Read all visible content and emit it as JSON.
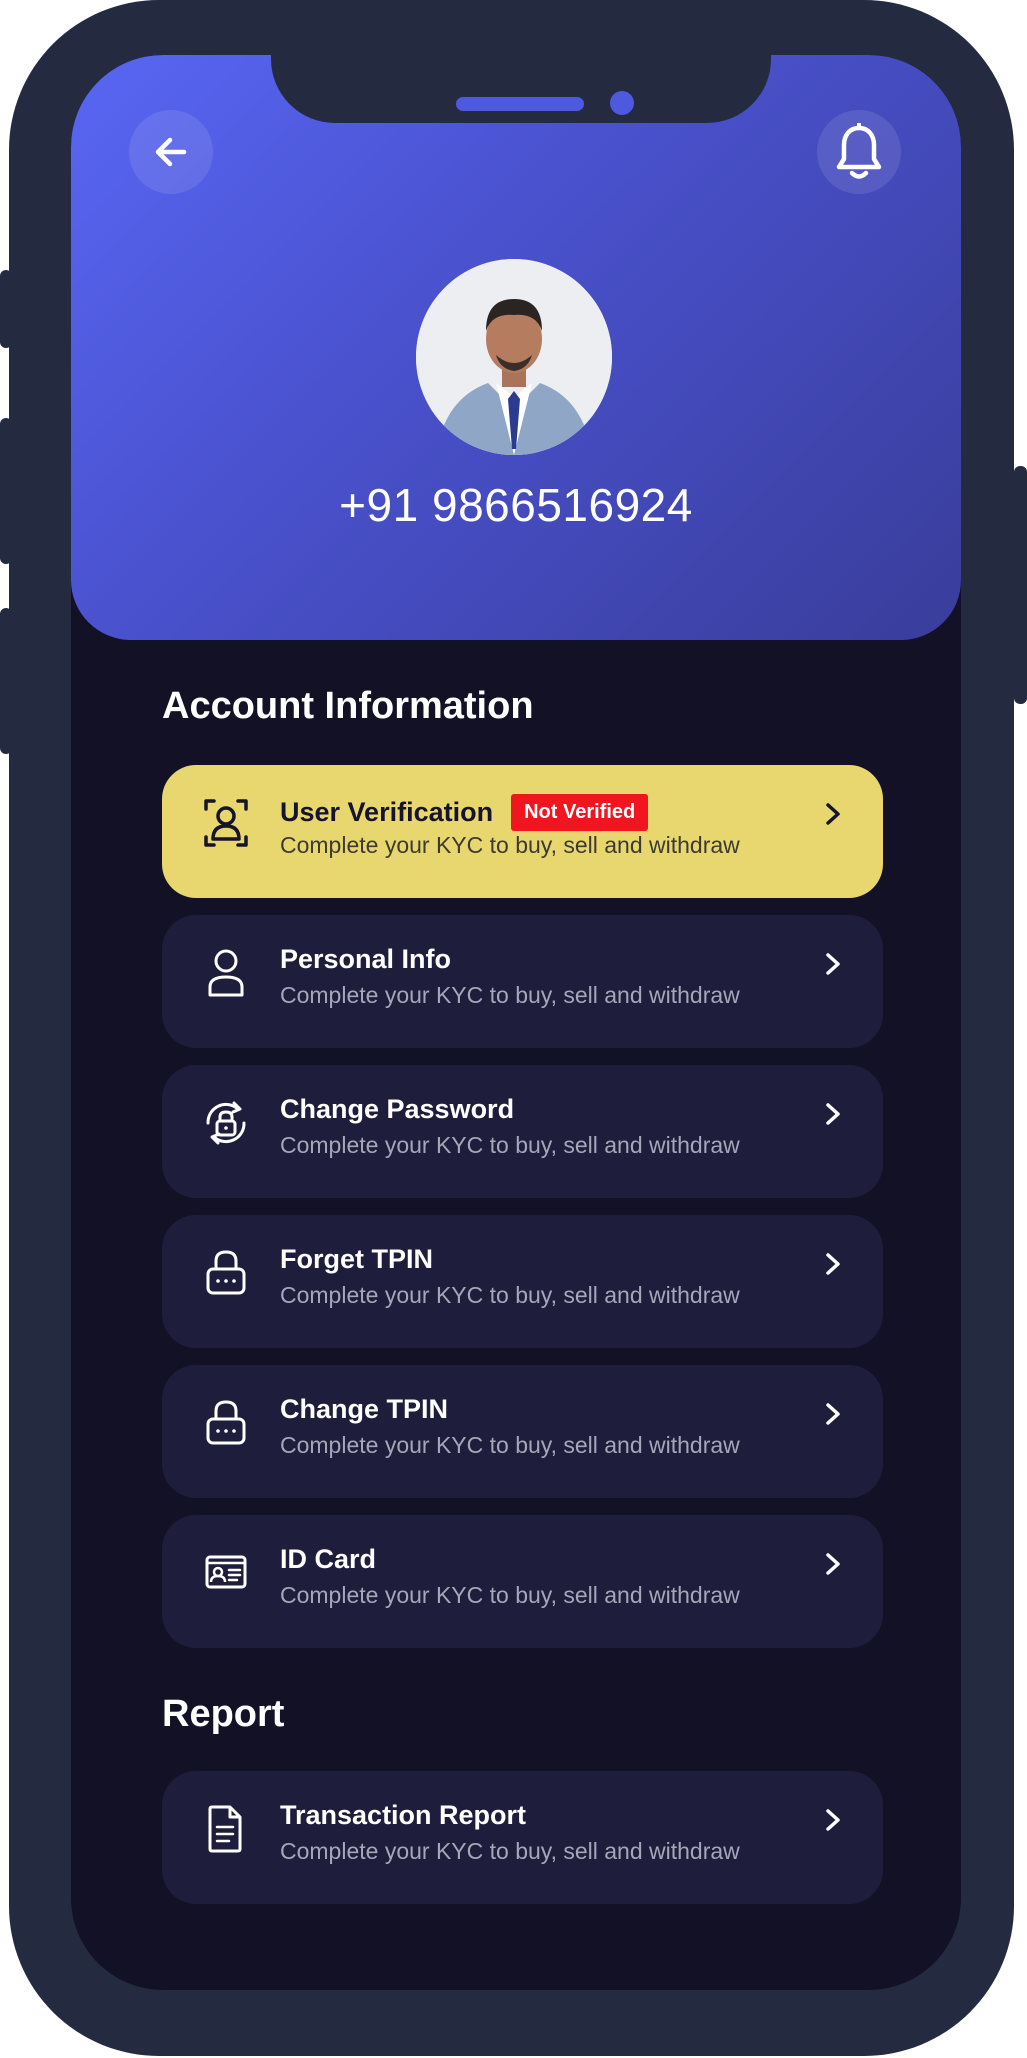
{
  "header": {
    "phone_number": "+91 9866516924",
    "back_icon": "arrow-left-icon",
    "notification_icon": "bell-icon"
  },
  "sections": {
    "account": {
      "title": "Account Information",
      "items": [
        {
          "title": "User Verification",
          "subtitle": "Complete your KYC to buy, sell and withdraw",
          "badge": "Not Verified",
          "icon": "face-scan-icon"
        },
        {
          "title": "Personal Info",
          "subtitle": "Complete your KYC to buy, sell and withdraw",
          "icon": "user-icon"
        },
        {
          "title": "Change Password",
          "subtitle": "Complete your KYC to buy, sell and withdraw",
          "icon": "lock-refresh-icon"
        },
        {
          "title": "Forget TPIN",
          "subtitle": "Complete your KYC to buy, sell and withdraw",
          "icon": "password-lock-icon"
        },
        {
          "title": "Change TPIN",
          "subtitle": "Complete your KYC to buy, sell and withdraw",
          "icon": "password-lock-icon"
        },
        {
          "title": "ID Card",
          "subtitle": "Complete your KYC to buy, sell and withdraw",
          "icon": "id-card-icon"
        }
      ]
    },
    "report": {
      "title": "Report",
      "items": [
        {
          "title": "Transaction Report",
          "subtitle": "Complete your KYC to buy, sell and withdraw",
          "icon": "document-icon"
        }
      ]
    }
  },
  "colors": {
    "header_gradient_start": "#5867f4",
    "header_gradient_end": "#393d9a",
    "background": "#131126",
    "card": "#1f1d3c",
    "highlight_card": "#e8d66f",
    "badge": "#f0151f"
  }
}
